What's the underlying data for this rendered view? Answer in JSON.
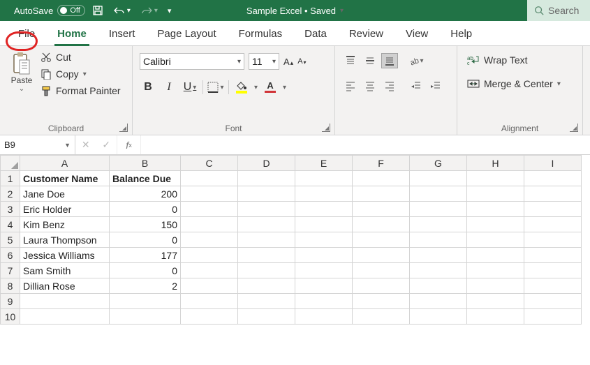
{
  "titlebar": {
    "autosave_label": "AutoSave",
    "autosave_state": "Off",
    "doc_title": "Sample Excel • Saved",
    "search_placeholder": "Search"
  },
  "tabs": [
    "File",
    "Home",
    "Insert",
    "Page Layout",
    "Formulas",
    "Data",
    "Review",
    "View",
    "Help"
  ],
  "active_tab": "Home",
  "ribbon": {
    "clipboard": {
      "label": "Clipboard",
      "paste": "Paste",
      "cut": "Cut",
      "copy": "Copy",
      "format_painter": "Format Painter"
    },
    "font": {
      "label": "Font",
      "name": "Calibri",
      "size": "11"
    },
    "alignment": {
      "label": "Alignment",
      "wrap": "Wrap Text",
      "merge": "Merge & Center"
    }
  },
  "formula_bar": {
    "name_box": "B9",
    "value": ""
  },
  "columns": [
    "A",
    "B",
    "C",
    "D",
    "E",
    "F",
    "G",
    "H",
    "I"
  ],
  "rows": [
    "1",
    "2",
    "3",
    "4",
    "5",
    "6",
    "7",
    "8",
    "9",
    "10"
  ],
  "sheet": {
    "headers": {
      "A": "Customer Name",
      "B": "Balance Due"
    },
    "data": [
      {
        "name": "Jane Doe",
        "balance": 200
      },
      {
        "name": "Eric Holder",
        "balance": 0
      },
      {
        "name": "Kim Benz",
        "balance": 150
      },
      {
        "name": "Laura Thompson",
        "balance": 0
      },
      {
        "name": "Jessica Williams",
        "balance": 177
      },
      {
        "name": "Sam Smith",
        "balance": 0
      },
      {
        "name": "Dillian Rose",
        "balance": 2
      }
    ]
  },
  "colors": {
    "brand": "#217346",
    "highlight": "#e02424"
  }
}
